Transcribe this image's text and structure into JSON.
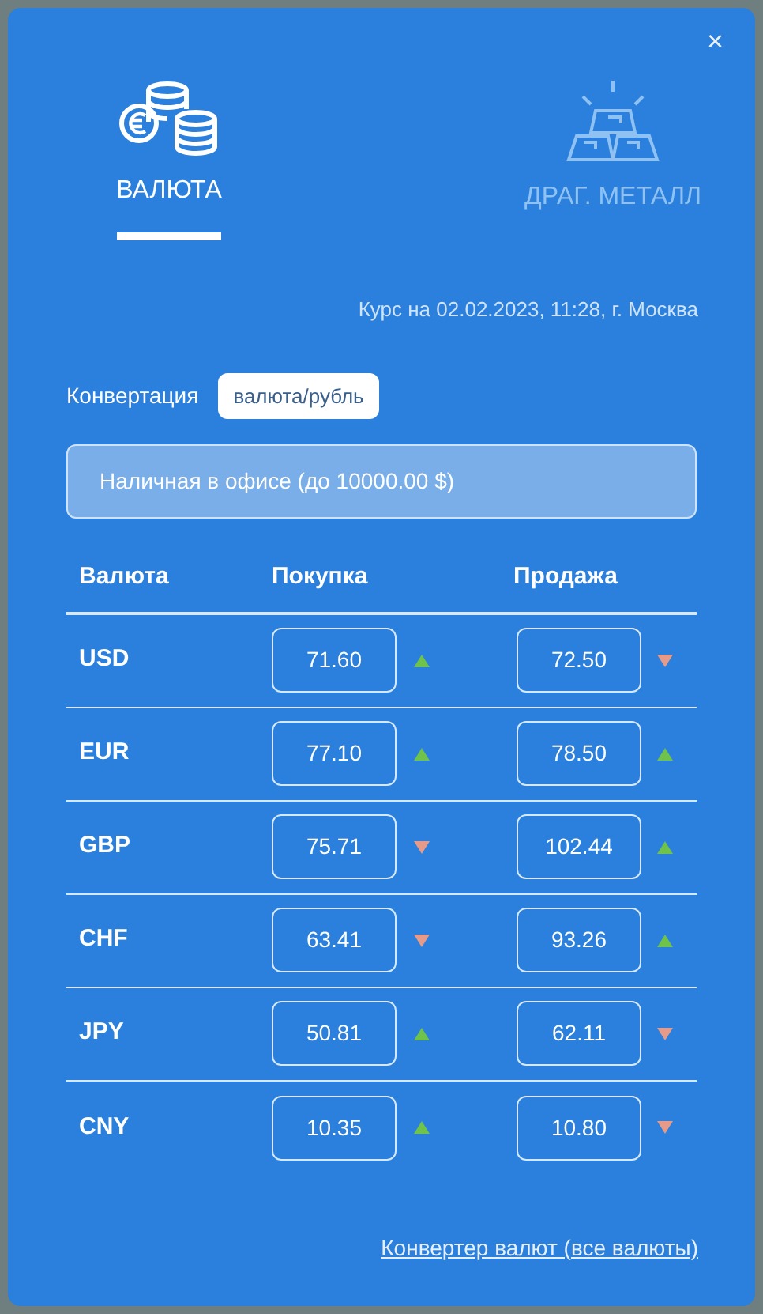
{
  "close": "×",
  "tabs": [
    {
      "label": "ВАЛЮТА",
      "kind": "coins",
      "selected": true
    },
    {
      "label": "ДРАГ. МЕТАЛЛ",
      "kind": "bars",
      "selected": false
    }
  ],
  "rate_info": "Курс на 02.02.2023, 11:28, г. Москва",
  "conversion": {
    "label": "Конвертация",
    "value": "валюта/рубль"
  },
  "cash_option": "Наличная в офисе (до 10000.00 $)",
  "table": {
    "columns": [
      "Валюта",
      "Покупка",
      "Продажа"
    ],
    "rows": [
      {
        "currency": "USD",
        "buy": "71.60",
        "buy_rising": true,
        "sell": "72.50",
        "sell_rising": false
      },
      {
        "currency": "EUR",
        "buy": "77.10",
        "buy_rising": true,
        "sell": "78.50",
        "sell_rising": true
      },
      {
        "currency": "GBP",
        "buy": "75.71",
        "buy_rising": false,
        "sell": "102.44",
        "sell_rising": true
      },
      {
        "currency": "CHF",
        "buy": "63.41",
        "buy_rising": false,
        "sell": "93.26",
        "sell_rising": true
      },
      {
        "currency": "JPY",
        "buy": "50.81",
        "buy_rising": true,
        "sell": "62.11",
        "sell_rising": false
      },
      {
        "currency": "CNY",
        "buy": "10.35",
        "buy_rising": true,
        "sell": "10.80",
        "sell_rising": false
      }
    ]
  },
  "converter_link": "Конвертер валют (все валюты)"
}
